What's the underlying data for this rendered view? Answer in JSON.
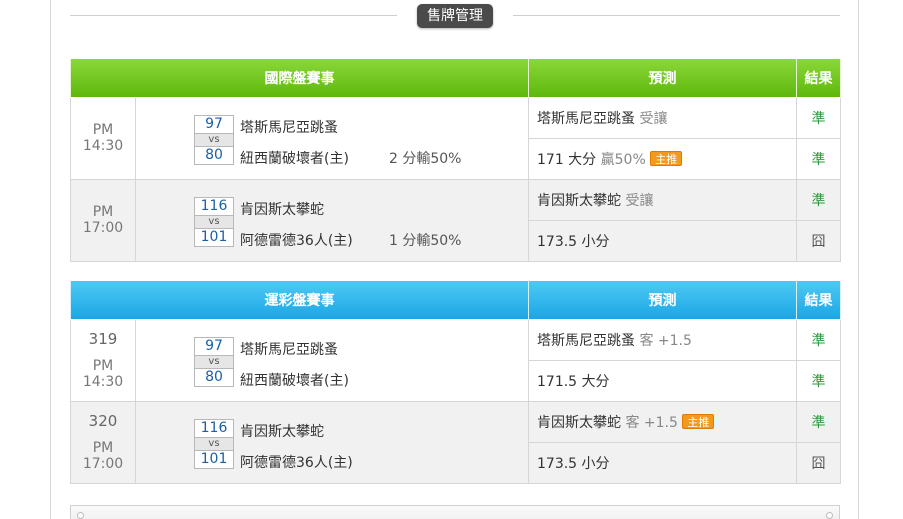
{
  "section_title": "售牌管理",
  "intl": {
    "headers": {
      "match": "國際盤賽事",
      "prediction": "預測",
      "result": "結果"
    },
    "games": [
      {
        "time": "PM 14:30",
        "home_score": "97",
        "vs": "vs",
        "away_score": "80",
        "team1": "塔斯馬尼亞跳蚤",
        "team2": "紐西蘭破壞者(主)",
        "handicap_result": "2 分輸50%",
        "pred1": {
          "main": "塔斯馬尼亞跳蚤",
          "note": "受讓",
          "result": "準"
        },
        "pred2": {
          "main": "171 大分",
          "note": "贏50%",
          "tag": "主推",
          "result": "準"
        }
      },
      {
        "time": "PM 17:00",
        "home_score": "116",
        "vs": "vs",
        "away_score": "101",
        "team1": "肯因斯太攀蛇",
        "team2": "阿德雷德36人(主)",
        "handicap_result": "1 分輸50%",
        "pred1": {
          "main": "肯因斯太攀蛇",
          "note": "受讓",
          "result": "準"
        },
        "pred2": {
          "main": "173.5 小分",
          "result": "囧"
        }
      }
    ]
  },
  "lottery": {
    "headers": {
      "match": "運彩盤賽事",
      "prediction": "預測",
      "result": "結果"
    },
    "games": [
      {
        "number": "319",
        "time": "PM 14:30",
        "home_score": "97",
        "vs": "vs",
        "away_score": "80",
        "team1": "塔斯馬尼亞跳蚤",
        "team2": "紐西蘭破壞者(主)",
        "pred1": {
          "main": "塔斯馬尼亞跳蚤",
          "note": "客 +1.5",
          "result": "準"
        },
        "pred2": {
          "main": "171.5 大分",
          "result": "準"
        }
      },
      {
        "number": "320",
        "time": "PM 17:00",
        "home_score": "116",
        "vs": "vs",
        "away_score": "101",
        "team1": "肯因斯太攀蛇",
        "team2": "阿德雷德36人(主)",
        "pred1": {
          "main": "肯因斯太攀蛇",
          "note": "客 +1.5",
          "tag": "主推",
          "result": "準"
        },
        "pred2": {
          "main": "173.5 小分",
          "result": "囧"
        }
      }
    ]
  },
  "colors": {
    "intl_header": "#6cc21b",
    "lottery_header": "#29b2ec",
    "hit": "#2a9a3c",
    "tag": "#f39a1e",
    "score_text": "#1b5fa6"
  }
}
